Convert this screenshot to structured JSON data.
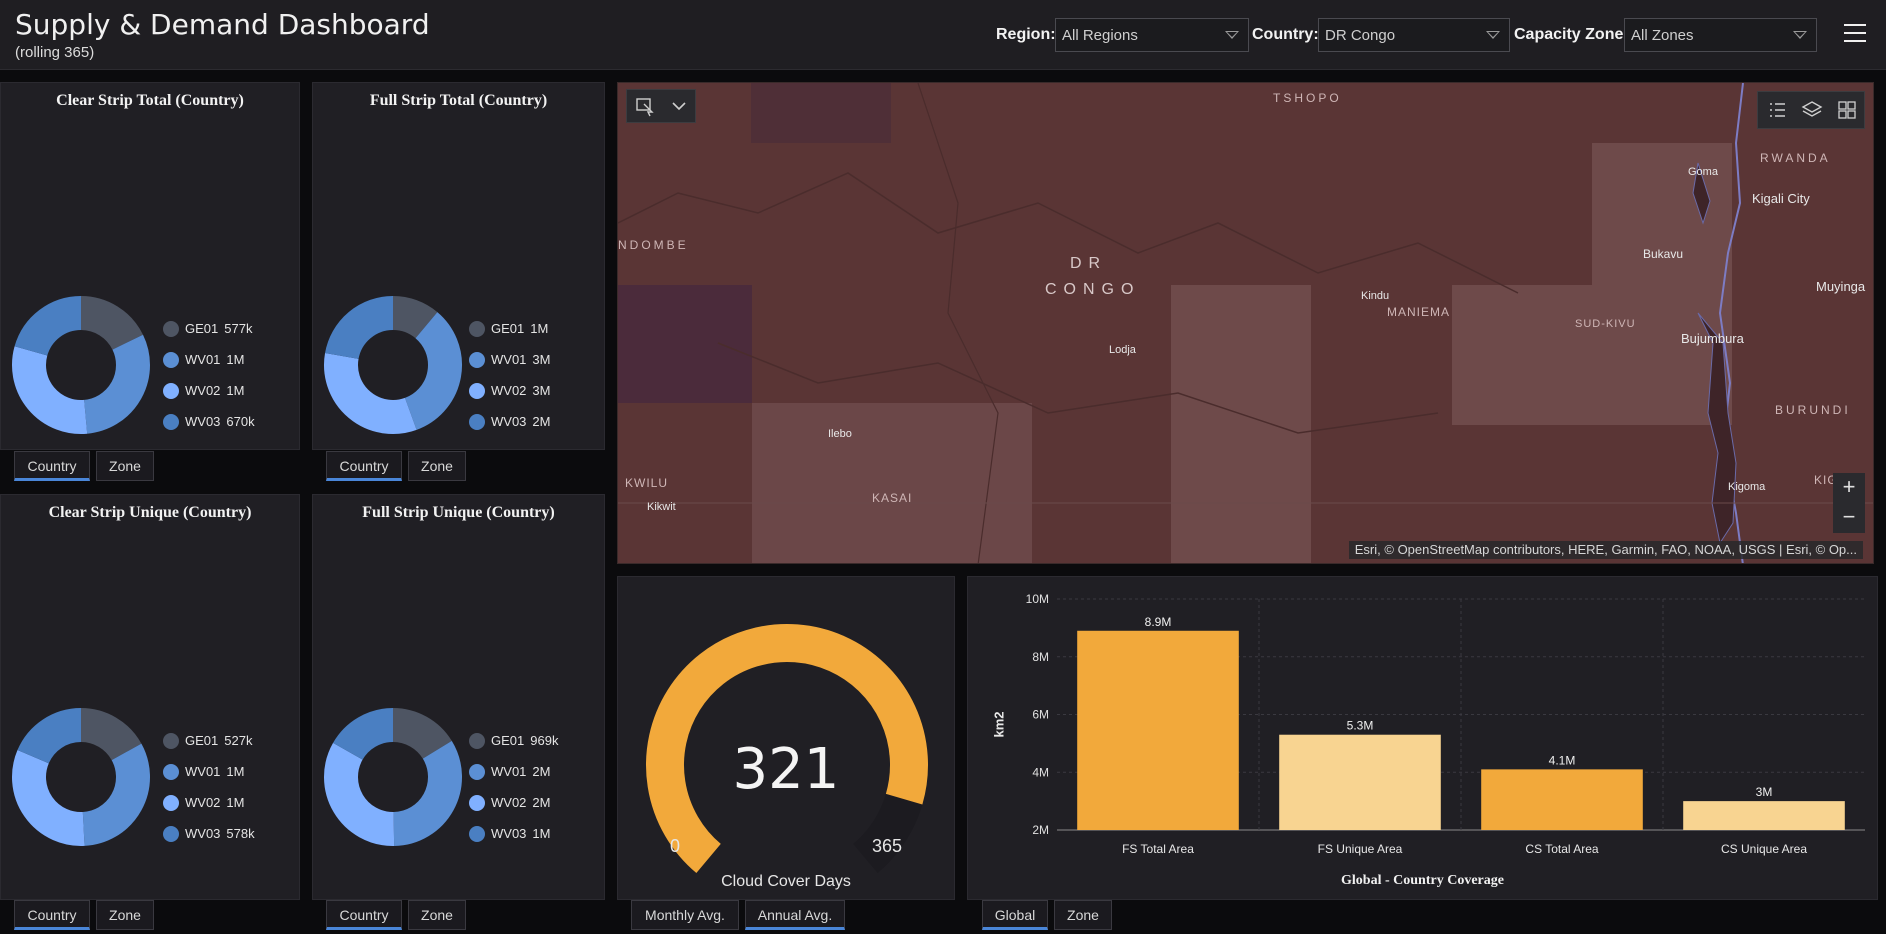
{
  "header": {
    "title": "Supply & Demand Dashboard",
    "subtitle": "(rolling 365)",
    "filters": {
      "region_label": "Region:",
      "region_value": "All Regions",
      "country_label": "Country:",
      "country_value": "DR Congo",
      "zone_label": "Capacity Zone:",
      "zone_value": "All Zones"
    }
  },
  "colors": {
    "ge01": "#4e5563",
    "wv01": "#5b8fd4",
    "wv02": "#80b0ff",
    "wv03": "#4a7fc2",
    "gauge": "#f2a93b",
    "bar_dark": "#f2a93b",
    "bar_light": "#f8d491",
    "tab_active": "#4a86d8"
  },
  "donuts": [
    {
      "title": "Clear Strip Total (Country)",
      "items": [
        {
          "label": "GE01",
          "value": 577,
          "display": "577k",
          "color_key": "ge01"
        },
        {
          "label": "WV01",
          "value": 1000,
          "display": "1M",
          "color_key": "wv01"
        },
        {
          "label": "WV02",
          "value": 1000,
          "display": "1M",
          "color_key": "wv02"
        },
        {
          "label": "WV03",
          "value": 670,
          "display": "670k",
          "color_key": "wv03"
        }
      ],
      "tabs": [
        {
          "label": "Country",
          "active": true
        },
        {
          "label": "Zone",
          "active": false
        }
      ]
    },
    {
      "title": "Full Strip Total (Country)",
      "items": [
        {
          "label": "GE01",
          "value": 1000,
          "display": "1M",
          "color_key": "ge01"
        },
        {
          "label": "WV01",
          "value": 3000,
          "display": "3M",
          "color_key": "wv01"
        },
        {
          "label": "WV02",
          "value": 3000,
          "display": "3M",
          "color_key": "wv02"
        },
        {
          "label": "WV03",
          "value": 2000,
          "display": "2M",
          "color_key": "wv03"
        }
      ],
      "tabs": [
        {
          "label": "Country",
          "active": true
        },
        {
          "label": "Zone",
          "active": false
        }
      ]
    },
    {
      "title": "Clear Strip Unique (Country)",
      "items": [
        {
          "label": "GE01",
          "value": 527,
          "display": "527k",
          "color_key": "ge01"
        },
        {
          "label": "WV01",
          "value": 1000,
          "display": "1M",
          "color_key": "wv01"
        },
        {
          "label": "WV02",
          "value": 1000,
          "display": "1M",
          "color_key": "wv02"
        },
        {
          "label": "WV03",
          "value": 578,
          "display": "578k",
          "color_key": "wv03"
        }
      ],
      "tabs": [
        {
          "label": "Country",
          "active": true
        },
        {
          "label": "Zone",
          "active": false
        }
      ]
    },
    {
      "title": "Full Strip Unique (Country)",
      "items": [
        {
          "label": "GE01",
          "value": 969,
          "display": "969k",
          "color_key": "ge01"
        },
        {
          "label": "WV01",
          "value": 2000,
          "display": "2M",
          "color_key": "wv01"
        },
        {
          "label": "WV02",
          "value": 2000,
          "display": "2M",
          "color_key": "wv02"
        },
        {
          "label": "WV03",
          "value": 1000,
          "display": "1M",
          "color_key": "wv03"
        }
      ],
      "tabs": [
        {
          "label": "Country",
          "active": true
        },
        {
          "label": "Zone",
          "active": false
        }
      ]
    }
  ],
  "map": {
    "labels": {
      "tshopo": "TSHOPO",
      "rwanda": "RWANDA",
      "goma": "Goma",
      "kigali": "Kigali City",
      "ndombe": "NDOMBE",
      "dr": "DR",
      "congo": "CONGO",
      "bukavu": "Bukavu",
      "kindu": "Kindu",
      "maniema": "MANIEMA",
      "sud_kivu": "SUD-KIVU",
      "muyinga": "Muyinga",
      "lodja": "Lodja",
      "bujumbura": "Bujumbura",
      "burundi": "BURUNDI",
      "ilebo": "Ilebo",
      "kwilu": "KWILU",
      "kigoma_region": "KIGOM",
      "kigoma": "Kigoma",
      "kasai": "KASAI",
      "kikwit": "Kikwit"
    },
    "zoom_in": "+",
    "zoom_out": "−",
    "attribution": "Esri, © OpenStreetMap contributors, HERE, Garmin, FAO, NOAA, USGS | Esri, © Op..."
  },
  "gauge": {
    "value": 321,
    "value_text": "321",
    "min": 0,
    "max": 365,
    "min_text": "0",
    "max_text": "365",
    "label": "Cloud Cover Days",
    "tabs": [
      {
        "label": "Monthly Avg.",
        "active": false
      },
      {
        "label": "Annual Avg.",
        "active": true
      }
    ]
  },
  "chart_data": {
    "type": "bar",
    "title": "Global - Country Coverage",
    "xlabel": "",
    "ylabel": "km2",
    "categories": [
      "FS Total Area",
      "FS Unique Area",
      "CS Total Area",
      "CS Unique Area"
    ],
    "values": [
      8900000,
      5300000,
      4100000,
      3000000
    ],
    "value_labels": [
      "8.9M",
      "5.3M",
      "4.1M",
      "3M"
    ],
    "color_keys": [
      "bar_dark",
      "bar_light",
      "bar_dark",
      "bar_light"
    ],
    "ylim": [
      2000000,
      10000000
    ],
    "yticks": [
      2000000,
      4000000,
      6000000,
      8000000,
      10000000
    ],
    "ytick_labels": [
      "2M",
      "4M",
      "6M",
      "8M",
      "10M"
    ],
    "grid": true
  },
  "bar_tabs": [
    {
      "label": "Global",
      "active": true
    },
    {
      "label": "Zone",
      "active": false
    }
  ]
}
